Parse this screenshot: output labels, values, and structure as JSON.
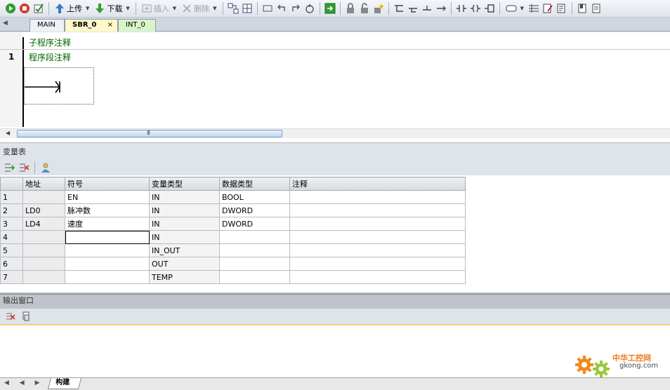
{
  "toolbar": {
    "upload_label": "上传",
    "download_label": "下载",
    "insert_label": "插入",
    "delete_label": "删除"
  },
  "editor_tabs": [
    {
      "label": "MAIN"
    },
    {
      "label": "SBR_0",
      "close": "×"
    },
    {
      "label": "INT_0"
    }
  ],
  "editor": {
    "subroutine_comment": "子程序注释",
    "network_number": "1",
    "network_comment": "程序段注释",
    "scroll_grip": "III"
  },
  "var_panel": {
    "title": "变量表",
    "columns": [
      "",
      "地址",
      "符号",
      "变量类型",
      "数据类型",
      "注释"
    ],
    "rows": [
      {
        "num": "1",
        "addr": "",
        "symbol": "EN",
        "var_type": "IN",
        "data_type": "BOOL",
        "comment": ""
      },
      {
        "num": "2",
        "addr": "LD0",
        "symbol": "脉冲数",
        "var_type": "IN",
        "data_type": "DWORD",
        "comment": ""
      },
      {
        "num": "3",
        "addr": "LD4",
        "symbol": "速度",
        "var_type": "IN",
        "data_type": "DWORD",
        "comment": ""
      },
      {
        "num": "4",
        "addr": "",
        "symbol": "",
        "var_type": "IN",
        "data_type": "",
        "comment": ""
      },
      {
        "num": "5",
        "addr": "",
        "symbol": "",
        "var_type": "IN_OUT",
        "data_type": "",
        "comment": ""
      },
      {
        "num": "6",
        "addr": "",
        "symbol": "",
        "var_type": "OUT",
        "data_type": "",
        "comment": ""
      },
      {
        "num": "7",
        "addr": "",
        "symbol": "",
        "var_type": "TEMP",
        "data_type": "",
        "comment": ""
      }
    ]
  },
  "output_panel": {
    "title": "输出窗口"
  },
  "bottom": {
    "build_tab": "构建",
    "nav": "◀ ◀ ▶ ▶"
  },
  "watermark": {
    "text": "中华工控网",
    "url": "gkong.com"
  },
  "colors": {
    "run_green": "#2e9e2e",
    "stop_red": "#d23a2a",
    "comment_green": "#006400",
    "sbr_tab": "#fff8c8",
    "int_tab": "#d8f5c8"
  }
}
